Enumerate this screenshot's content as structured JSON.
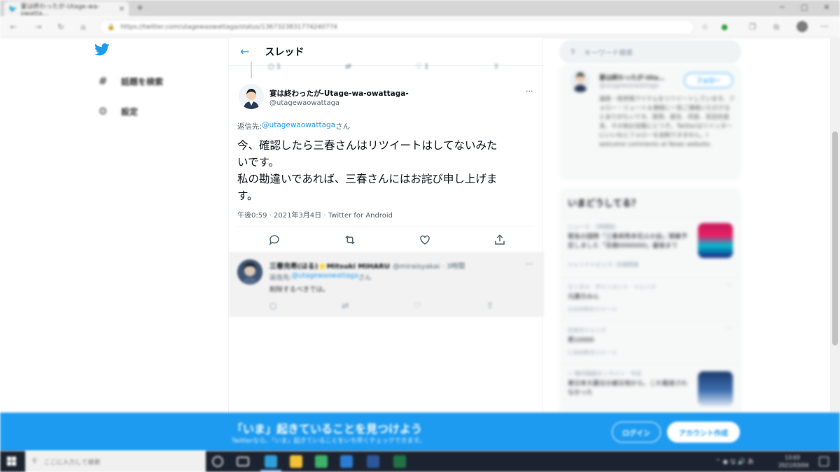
{
  "browser": {
    "tab_title": "宴は終わったが-Utage-wa-owatta…",
    "url": "https://twitter.com/utagewaowattaga/status/1367323831774240774"
  },
  "nav": {
    "explore_label": "話題を検索",
    "settings_label": "設定"
  },
  "thread": {
    "header_title": "スレッド",
    "prev_reply_count": "1",
    "prev_like_count": "1",
    "tweet": {
      "display_name": "宴は終わったが-Utage-wa-owattaga-",
      "handle": "@utagewaowattaga",
      "reply_to_prefix": "返信先: ",
      "reply_to_handle": "@utagewaowattaga",
      "reply_to_suffix": "さん",
      "text_line1": "今、確認したら三春さんはリツイートはしてないみた",
      "text_line2": "いです。",
      "text_line3": "私の勘違いであれば、三春さんにはお詫び申し上げま",
      "text_line4": "す。",
      "meta": "午後0:59 · 2021年3月4日 · Twitter for Android"
    },
    "reply": {
      "display_name": "三春充希(はる)⭐Mitsuki MIHARU",
      "handle": "@miraisyakai · 3時間",
      "reply_to_prefix": "返信先: ",
      "reply_to_handle": "@utagewaowattaga",
      "reply_to_suffix": "さん",
      "text": "削除するべきでは。"
    }
  },
  "sidebar": {
    "search_placeholder": "キーワード検索",
    "profile": {
      "name": "宴は終わったが-Uta…",
      "handle": "@utagewaowattaga",
      "follow_label": "フォロー",
      "bio": "議員・政党等アイテムをリツイートしています。フォロー・ミュート＆連絡に一気ご連絡いただけるとありがたいです。質問、提言、同意、否定的意見、その他お気軽にどうぞ。Twitterはツイッターにいいねとフォローを自制できません。I welcome comments at News website."
    },
    "trends_title": "いまどうしてる？",
    "trends": [
      {
        "meta": "ニュース · 3時間前",
        "title": "緊急の国際「三重県熊本花火の会」開幕予定しました「百歳0000000」最後まで",
        "count": "トレンドトピック: 吉報関連"
      },
      {
        "meta": "エンタメ · ザインメント · トレンド",
        "title": "元康方みん",
        "count": "3,035件のツイート"
      },
      {
        "meta": "日本のトレンド",
        "title": "男10000",
        "count": "1,000件のツイート"
      },
      {
        "meta": "☆ 現代国語オンライン · 今日",
        "title": "東日本大震災の被災地から。これ報道されなかった",
        "count": ""
      }
    ]
  },
  "banner": {
    "title": "「いま」起きていることを見つけよう",
    "subtitle": "Twitterなら、「いま」起きていることをいち早くチェックできます。",
    "login_label": "ログイン",
    "signup_label": "アカウント作成"
  },
  "taskbar": {
    "search_placeholder": "ここに入力して検索",
    "clock_time": "13:03",
    "clock_date": "2021/03/04"
  },
  "colors": {
    "twitter_blue": "#1d9bf0",
    "text_primary": "#0f1419",
    "text_secondary": "#536471",
    "taskbar": "#1c2330"
  }
}
